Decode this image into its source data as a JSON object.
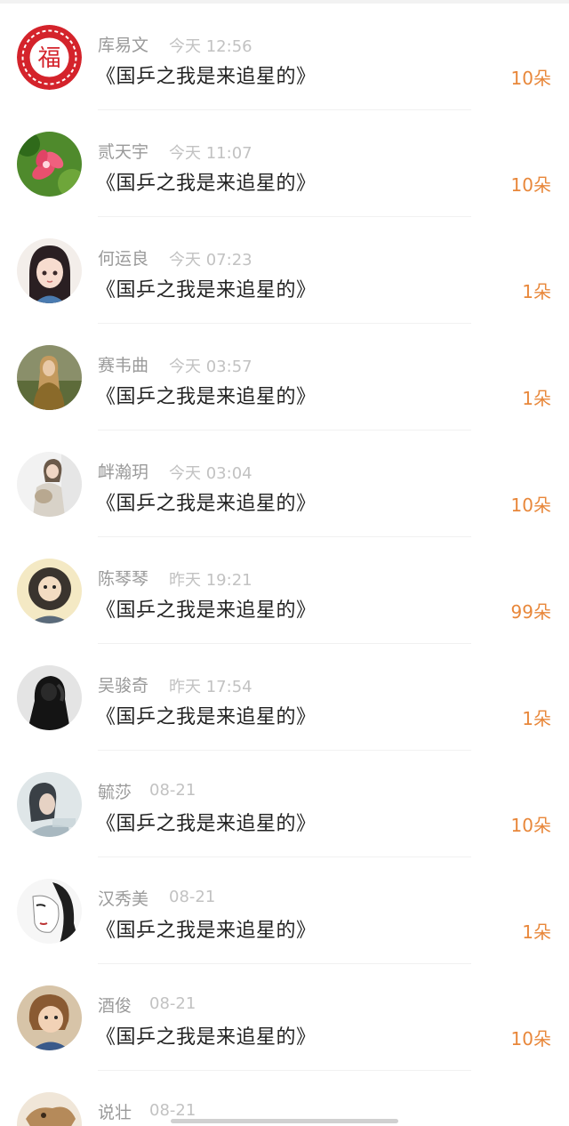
{
  "colors": {
    "amount": "#e8873a",
    "name": "#9a9a9a",
    "time": "#c2c2c2",
    "title": "#222222"
  },
  "rows": [
    {
      "name": "库易文",
      "time": "今天 12:56",
      "title": "《国乒之我是来追星的》",
      "amount": "10朵",
      "avatar_icon": "fu-character-icon"
    },
    {
      "name": "贰天宇",
      "time": "今天 11:07",
      "title": "《国乒之我是来追星的》",
      "amount": "10朵",
      "avatar_icon": "pink-flower-icon"
    },
    {
      "name": "何运良",
      "time": "今天 07:23",
      "title": "《国乒之我是来追星的》",
      "amount": "1朵",
      "avatar_icon": "cartoon-girl-icon"
    },
    {
      "name": "赛韦曲",
      "time": "今天 03:57",
      "title": "《国乒之我是来追星的》",
      "amount": "1朵",
      "avatar_icon": "girl-photo-icon"
    },
    {
      "name": "衅瀚玥",
      "time": "今天 03:04",
      "title": "《国乒之我是来追星的》",
      "amount": "10朵",
      "avatar_icon": "girl-holding-pet-icon"
    },
    {
      "name": "陈琴琴",
      "time": "昨天 19:21",
      "title": "《国乒之我是来追星的》",
      "amount": "99朵",
      "avatar_icon": "cartoon-bearded-man-icon"
    },
    {
      "name": "吴骏奇",
      "time": "昨天 17:54",
      "title": "《国乒之我是来追星的》",
      "amount": "1朵",
      "avatar_icon": "hooded-figure-icon"
    },
    {
      "name": "毓莎",
      "time": "08-21",
      "title": "《国乒之我是来追星的》",
      "amount": "10朵",
      "avatar_icon": "girl-profile-photo-icon"
    },
    {
      "name": "汉秀美",
      "time": "08-21",
      "title": "《国乒之我是来追星的》",
      "amount": "1朵",
      "avatar_icon": "ink-sketch-face-icon"
    },
    {
      "name": "酒俊",
      "time": "08-21",
      "title": "《国乒之我是来追星的》",
      "amount": "10朵",
      "avatar_icon": "child-photo-icon"
    },
    {
      "name": "说壮",
      "time": "08-21",
      "title": "",
      "amount": "",
      "avatar_icon": "cartoon-animal-icon"
    }
  ]
}
